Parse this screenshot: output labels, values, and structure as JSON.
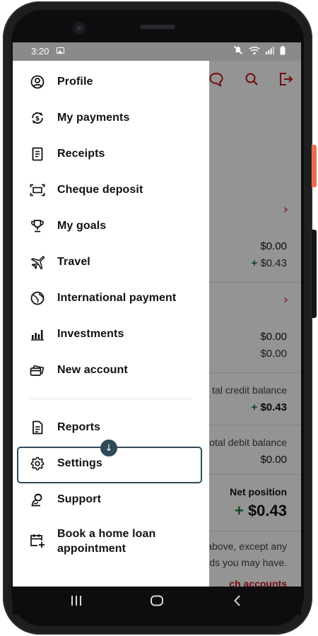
{
  "status_bar": {
    "time": "3:20",
    "icons": [
      "image-icon",
      "mute-icon",
      "wifi-icon",
      "signal-icon",
      "battery-icon"
    ]
  },
  "background_app": {
    "header_icons": [
      "chat-icon",
      "search-icon",
      "logout-icon"
    ],
    "accounts": [
      {
        "amount": "$0.00",
        "secondary": "$0.43",
        "secondary_positive": true
      },
      {
        "amount": "$0.00",
        "secondary": "$0.00",
        "secondary_positive": false
      }
    ],
    "credit_balance": {
      "label": "tal credit balance",
      "value": "$0.43"
    },
    "debit_balance": {
      "label": "otal debit balance",
      "value": "$0.00"
    },
    "net_position": {
      "label": "Net position",
      "value": "$0.43"
    },
    "footnote": [
      "above, except any",
      "ds you may have."
    ],
    "link_text": "ch accounts",
    "accent_color": "#c4161c",
    "positive_color": "#1a7f37"
  },
  "drawer": {
    "items": [
      {
        "label": "Profile",
        "icon": "profile-icon"
      },
      {
        "label": "My payments",
        "icon": "payments-icon"
      },
      {
        "label": "Receipts",
        "icon": "receipt-icon"
      },
      {
        "label": "Cheque deposit",
        "icon": "cheque-scan-icon"
      },
      {
        "label": "My goals",
        "icon": "trophy-icon"
      },
      {
        "label": "Travel",
        "icon": "plane-icon"
      },
      {
        "label": "International payment",
        "icon": "globe-icon"
      },
      {
        "label": "Investments",
        "icon": "bar-chart-icon"
      },
      {
        "label": "New account",
        "icon": "cards-icon"
      }
    ],
    "secondary_items": [
      {
        "label": "Reports",
        "icon": "report-icon"
      },
      {
        "label": "Settings",
        "icon": "gear-icon",
        "highlighted": true
      },
      {
        "label": "Support",
        "icon": "support-icon"
      },
      {
        "label": "Book a home loan\nappointment",
        "icon": "calendar-add-icon"
      }
    ],
    "marker_glyph": "↓",
    "highlight_color": "#314b57"
  },
  "nav_bar": {
    "buttons": [
      "recents-icon",
      "home-icon",
      "back-icon"
    ]
  }
}
